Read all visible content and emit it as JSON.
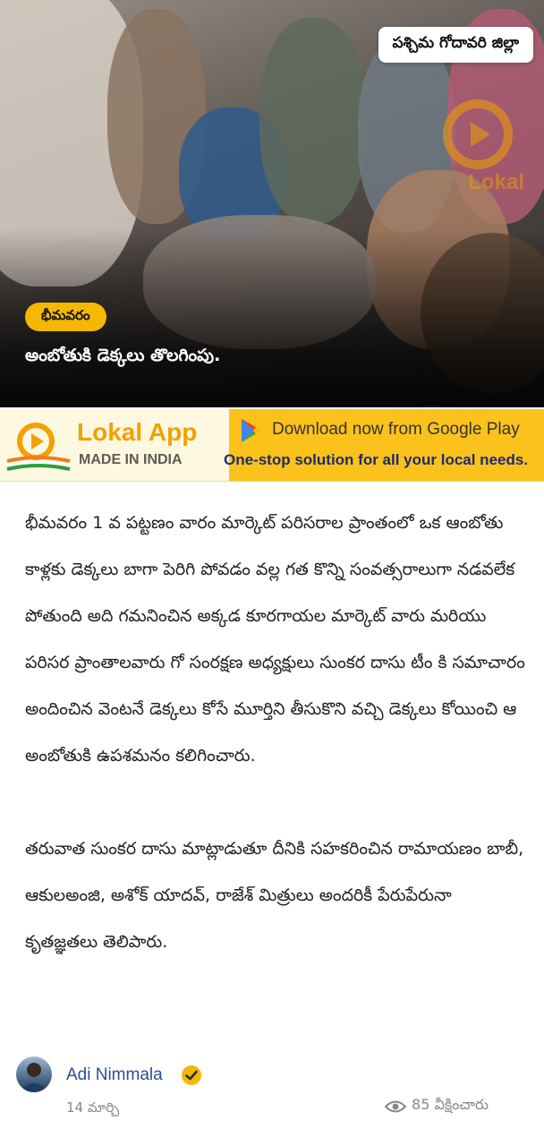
{
  "hero": {
    "district_tag": "పశ్చిమ గోదావరి జిల్లా",
    "watermark_text": "Lokal",
    "city_chip": "భీమవరం",
    "headline": "అంబోతుకి డెక్కలు తొలగింపు."
  },
  "banner": {
    "brand": "Lokal App",
    "made_in": "MADE IN INDIA",
    "download": "Download now from Google Play",
    "tagline": "One-stop solution for all your local needs.",
    "accent_color": "#fbc21c"
  },
  "article": {
    "paragraphs": [
      "భీమవరం 1 వ పట్టణం వారం మార్కెట్ పరిసరాల ప్రాంతంలో ఒక ఆంబోతు కాళ్లకు డెక్కలు బాగా పెరిగి పోవడం వల్ల గత కొన్ని సంవత్సరాలుగా నడవలేక పోతుంది అది గమనించిన అక్కడ కూరగాయల మార్కెట్ వారు మరియు పరిసర ప్రాంతాలవారు గో సంరక్షణ అధ్యక్షులు సుంకర దాసు టీం కి సమాచారం అందించిన వెంటనే డెక్కలు కోసే మూర్తిని తీసుకొని వచ్చి డెక్కలు కోయించి ఆ అంబోతుకి ఉపశమనం కలిగించారు.",
      "తరువాత సుంకర దాసు మాట్లాడుతూ దీనికి సహకరించిన రామాయణం బాబీ, ఆకులఅంజి, అశోక్ యాదవ్, రాజేశ్ మిత్రులు అందరికీ పేరుపేరునా కృతజ్ఞతలు తెలిపారు."
    ]
  },
  "author": {
    "name": "Adi Nimmala",
    "date": "14 మార్చి",
    "views": "85 వీక్షించారు"
  }
}
